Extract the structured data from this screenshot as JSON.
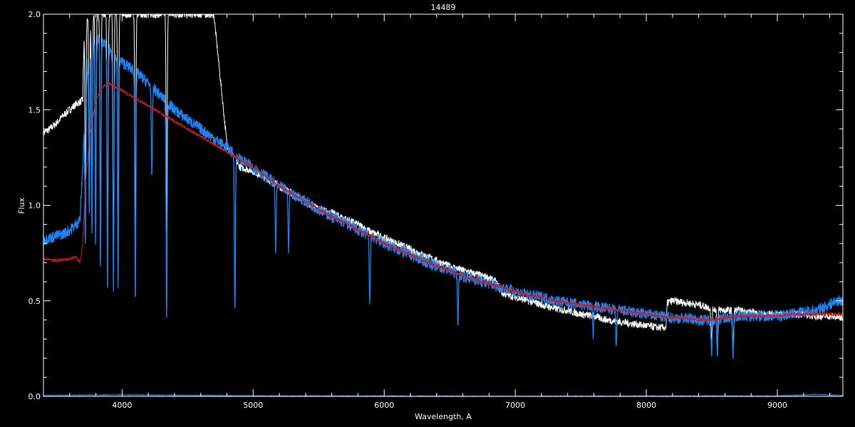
{
  "chart_data": {
    "type": "line",
    "title": "14489",
    "xlabel": "Wavelength, A",
    "ylabel": "Flux",
    "xlim": [
      3400,
      9500
    ],
    "ylim": [
      0.0,
      2.0
    ],
    "x_ticks": [
      4000,
      5000,
      6000,
      7000,
      8000,
      9000
    ],
    "x_tick_labels": [
      "4000",
      "5000",
      "6000",
      "7000",
      "8000",
      "9000"
    ],
    "y_ticks": [
      0.0,
      0.5,
      1.0,
      1.5,
      2.0
    ],
    "y_tick_labels": [
      "0.0",
      "0.5",
      "1.0",
      "1.5",
      "2.0"
    ],
    "x_minor_step": 200,
    "y_minor_step": 0.1,
    "grid": false,
    "background": "#000000",
    "axis_color": "#ffffff",
    "series": [
      {
        "color": "#ffffff",
        "noise": 0.02,
        "x": [
          3400,
          3450,
          3500,
          3550,
          3600,
          3650,
          3700,
          3710,
          3750,
          3800,
          3850,
          3900,
          3950,
          4000,
          4100,
          4200,
          4300,
          4400,
          4500,
          4600,
          4700,
          4800,
          4900,
          5000,
          5100,
          5200,
          5300,
          5400,
          5500,
          5600,
          5700,
          5800,
          5900,
          6000,
          6100,
          6200,
          6300,
          6400,
          6500,
          6600,
          6700,
          6800,
          6850,
          6900,
          7000,
          7100,
          7200,
          7300,
          7400,
          7500,
          7600,
          7700,
          7800,
          7900,
          8000,
          8100,
          8150,
          8160,
          8200,
          8300,
          8400,
          8500,
          8600,
          8700,
          8800,
          8900,
          9000,
          9100,
          9200,
          9300,
          9400,
          9500
        ],
        "y": [
          1.38,
          1.4,
          1.43,
          1.47,
          1.5,
          1.53,
          1.55,
          1.9,
          2.0,
          2.0,
          2.0,
          2.0,
          2.0,
          2.0,
          2.0,
          2.0,
          2.0,
          2.0,
          2.0,
          2.0,
          2.0,
          1.32,
          1.2,
          1.18,
          1.14,
          1.1,
          1.06,
          1.02,
          0.98,
          0.96,
          0.93,
          0.9,
          0.86,
          0.83,
          0.8,
          0.77,
          0.74,
          0.71,
          0.68,
          0.66,
          0.64,
          0.62,
          0.6,
          0.54,
          0.52,
          0.5,
          0.48,
          0.46,
          0.45,
          0.43,
          0.42,
          0.4,
          0.39,
          0.38,
          0.37,
          0.36,
          0.36,
          0.49,
          0.5,
          0.49,
          0.48,
          0.46,
          0.45,
          0.45,
          0.44,
          0.43,
          0.43,
          0.43,
          0.43,
          0.42,
          0.42,
          0.41
        ]
      },
      {
        "color": "#1e82f0",
        "noise": 0.03,
        "x": [
          3400,
          3450,
          3500,
          3550,
          3600,
          3650,
          3680,
          3700,
          3720,
          3750,
          3800,
          3850,
          3900,
          3950,
          4000,
          4100,
          4200,
          4300,
          4400,
          4500,
          4600,
          4700,
          4800,
          4900,
          5000,
          5100,
          5200,
          5300,
          5400,
          5500,
          5600,
          5700,
          5800,
          5900,
          6000,
          6100,
          6200,
          6300,
          6400,
          6500,
          6600,
          6700,
          6800,
          6900,
          7000,
          7100,
          7200,
          7300,
          7400,
          7500,
          7600,
          7700,
          7800,
          7900,
          8000,
          8100,
          8200,
          8300,
          8400,
          8500,
          8600,
          8700,
          8800,
          8900,
          9000,
          9100,
          9200,
          9300,
          9400,
          9450,
          9500
        ],
        "y": [
          0.82,
          0.83,
          0.84,
          0.85,
          0.87,
          0.9,
          0.93,
          1.2,
          1.6,
          1.85,
          1.88,
          1.85,
          1.82,
          1.78,
          1.75,
          1.7,
          1.64,
          1.57,
          1.5,
          1.45,
          1.4,
          1.35,
          1.3,
          1.24,
          1.2,
          1.15,
          1.1,
          1.06,
          1.02,
          0.98,
          0.94,
          0.91,
          0.87,
          0.84,
          0.8,
          0.77,
          0.74,
          0.71,
          0.68,
          0.66,
          0.63,
          0.61,
          0.59,
          0.57,
          0.55,
          0.53,
          0.52,
          0.5,
          0.49,
          0.48,
          0.47,
          0.46,
          0.45,
          0.44,
          0.43,
          0.42,
          0.41,
          0.41,
          0.4,
          0.4,
          0.41,
          0.42,
          0.42,
          0.42,
          0.42,
          0.43,
          0.44,
          0.45,
          0.48,
          0.5,
          0.5
        ]
      },
      {
        "color": "#c81e1e",
        "noise": 0.008,
        "x": [
          3400,
          3500,
          3600,
          3650,
          3680,
          3700,
          3720,
          3750,
          3800,
          3850,
          3900,
          3950,
          4000,
          4100,
          4200,
          4300,
          4400,
          4500,
          4600,
          4700,
          4800,
          4900,
          5000,
          5100,
          5200,
          5300,
          5400,
          5500,
          5600,
          5700,
          5800,
          5900,
          6000,
          6100,
          6200,
          6300,
          6400,
          6500,
          6600,
          6700,
          6800,
          6900,
          7000,
          7100,
          7200,
          7300,
          7400,
          7500,
          7600,
          7700,
          7800,
          7900,
          8000,
          8100,
          8200,
          8300,
          8400,
          8500,
          8600,
          8700,
          8800,
          8900,
          9000,
          9100,
          9200,
          9300,
          9400,
          9500
        ],
        "y": [
          0.72,
          0.71,
          0.72,
          0.73,
          0.7,
          0.8,
          1.1,
          1.35,
          1.55,
          1.62,
          1.64,
          1.62,
          1.6,
          1.56,
          1.52,
          1.48,
          1.44,
          1.4,
          1.36,
          1.32,
          1.28,
          1.24,
          1.2,
          1.15,
          1.1,
          1.06,
          1.02,
          0.98,
          0.94,
          0.91,
          0.87,
          0.84,
          0.8,
          0.77,
          0.74,
          0.71,
          0.68,
          0.66,
          0.63,
          0.61,
          0.59,
          0.57,
          0.55,
          0.53,
          0.52,
          0.5,
          0.49,
          0.48,
          0.47,
          0.46,
          0.45,
          0.44,
          0.43,
          0.42,
          0.41,
          0.41,
          0.4,
          0.4,
          0.41,
          0.42,
          0.42,
          0.42,
          0.42,
          0.43,
          0.43,
          0.43,
          0.43,
          0.43
        ]
      },
      {
        "color": "#1e82f0",
        "noise": 0.002,
        "x": [
          3400,
          4000,
          5000,
          6000,
          7000,
          8000,
          9000,
          9300,
          9500
        ],
        "y": [
          0.005,
          0.008,
          0.003,
          0.002,
          0.001,
          0.002,
          0.002,
          0.01,
          0.005
        ]
      }
    ],
    "absorption_lines": [
      {
        "x": 3720,
        "depth": 0.8,
        "series": [
          0,
          1
        ]
      },
      {
        "x": 3750,
        "depth": 0.9,
        "series": [
          0,
          1
        ]
      },
      {
        "x": 3770,
        "depth": 1.0,
        "series": [
          0,
          1
        ]
      },
      {
        "x": 3798,
        "depth": 1.1,
        "series": [
          0,
          1
        ]
      },
      {
        "x": 3835,
        "depth": 1.2,
        "series": [
          0,
          1
        ]
      },
      {
        "x": 3889,
        "depth": 1.3,
        "series": [
          0,
          1
        ]
      },
      {
        "x": 3934,
        "depth": 1.25,
        "series": [
          0,
          1
        ]
      },
      {
        "x": 3970,
        "depth": 1.2,
        "series": [
          0,
          1
        ]
      },
      {
        "x": 4101,
        "depth": 1.2,
        "series": [
          0,
          1
        ]
      },
      {
        "x": 4227,
        "depth": 0.5,
        "series": [
          1
        ]
      },
      {
        "x": 4340,
        "depth": 1.15,
        "series": [
          0,
          1
        ]
      },
      {
        "x": 4861,
        "depth": 0.8,
        "series": [
          0,
          1
        ]
      },
      {
        "x": 5172,
        "depth": 0.35,
        "series": [
          1
        ]
      },
      {
        "x": 5270,
        "depth": 0.3,
        "series": [
          1
        ]
      },
      {
        "x": 5890,
        "depth": 0.38,
        "series": [
          1
        ]
      },
      {
        "x": 6563,
        "depth": 0.25,
        "series": [
          1
        ]
      },
      {
        "x": 7595,
        "depth": 0.15,
        "series": [
          1
        ]
      },
      {
        "x": 7771,
        "depth": 0.2,
        "series": [
          1
        ]
      },
      {
        "x": 8498,
        "depth": 0.18,
        "series": [
          0,
          1
        ]
      },
      {
        "x": 8542,
        "depth": 0.2,
        "series": [
          0,
          1
        ]
      },
      {
        "x": 8662,
        "depth": 0.2,
        "series": [
          0,
          1
        ]
      }
    ],
    "emission_spikes": [
      {
        "x": 4450,
        "height": 2.0
      },
      {
        "x": 4480,
        "height": 2.0
      },
      {
        "x": 4520,
        "height": 2.0
      },
      {
        "x": 4560,
        "height": 2.0
      },
      {
        "x": 4620,
        "height": 2.0
      },
      {
        "x": 4680,
        "height": 2.0
      }
    ]
  }
}
